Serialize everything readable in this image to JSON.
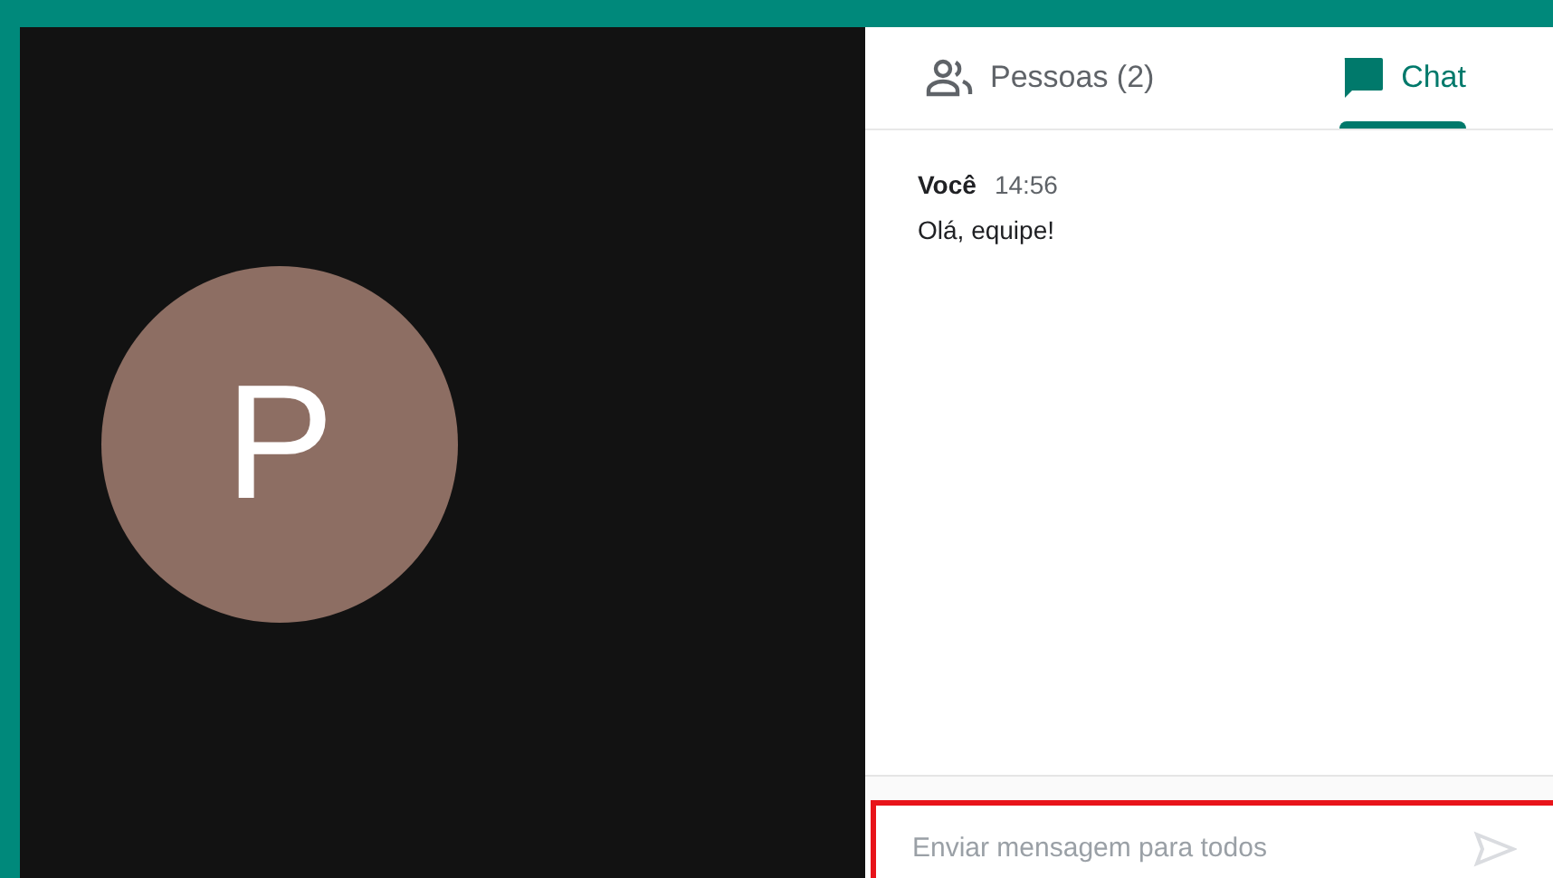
{
  "participant": {
    "initial": "P"
  },
  "tabs": [
    {
      "kind": "people",
      "label": "Pessoas (2)",
      "selected": false
    },
    {
      "kind": "chat",
      "label": "Chat",
      "selected": true
    }
  ],
  "messages": [
    {
      "sender": "Você",
      "time": "14:56",
      "text": "Olá, equipe!"
    }
  ],
  "composer": {
    "placeholder": "Enviar mensagem para todos",
    "highlighted": true
  }
}
